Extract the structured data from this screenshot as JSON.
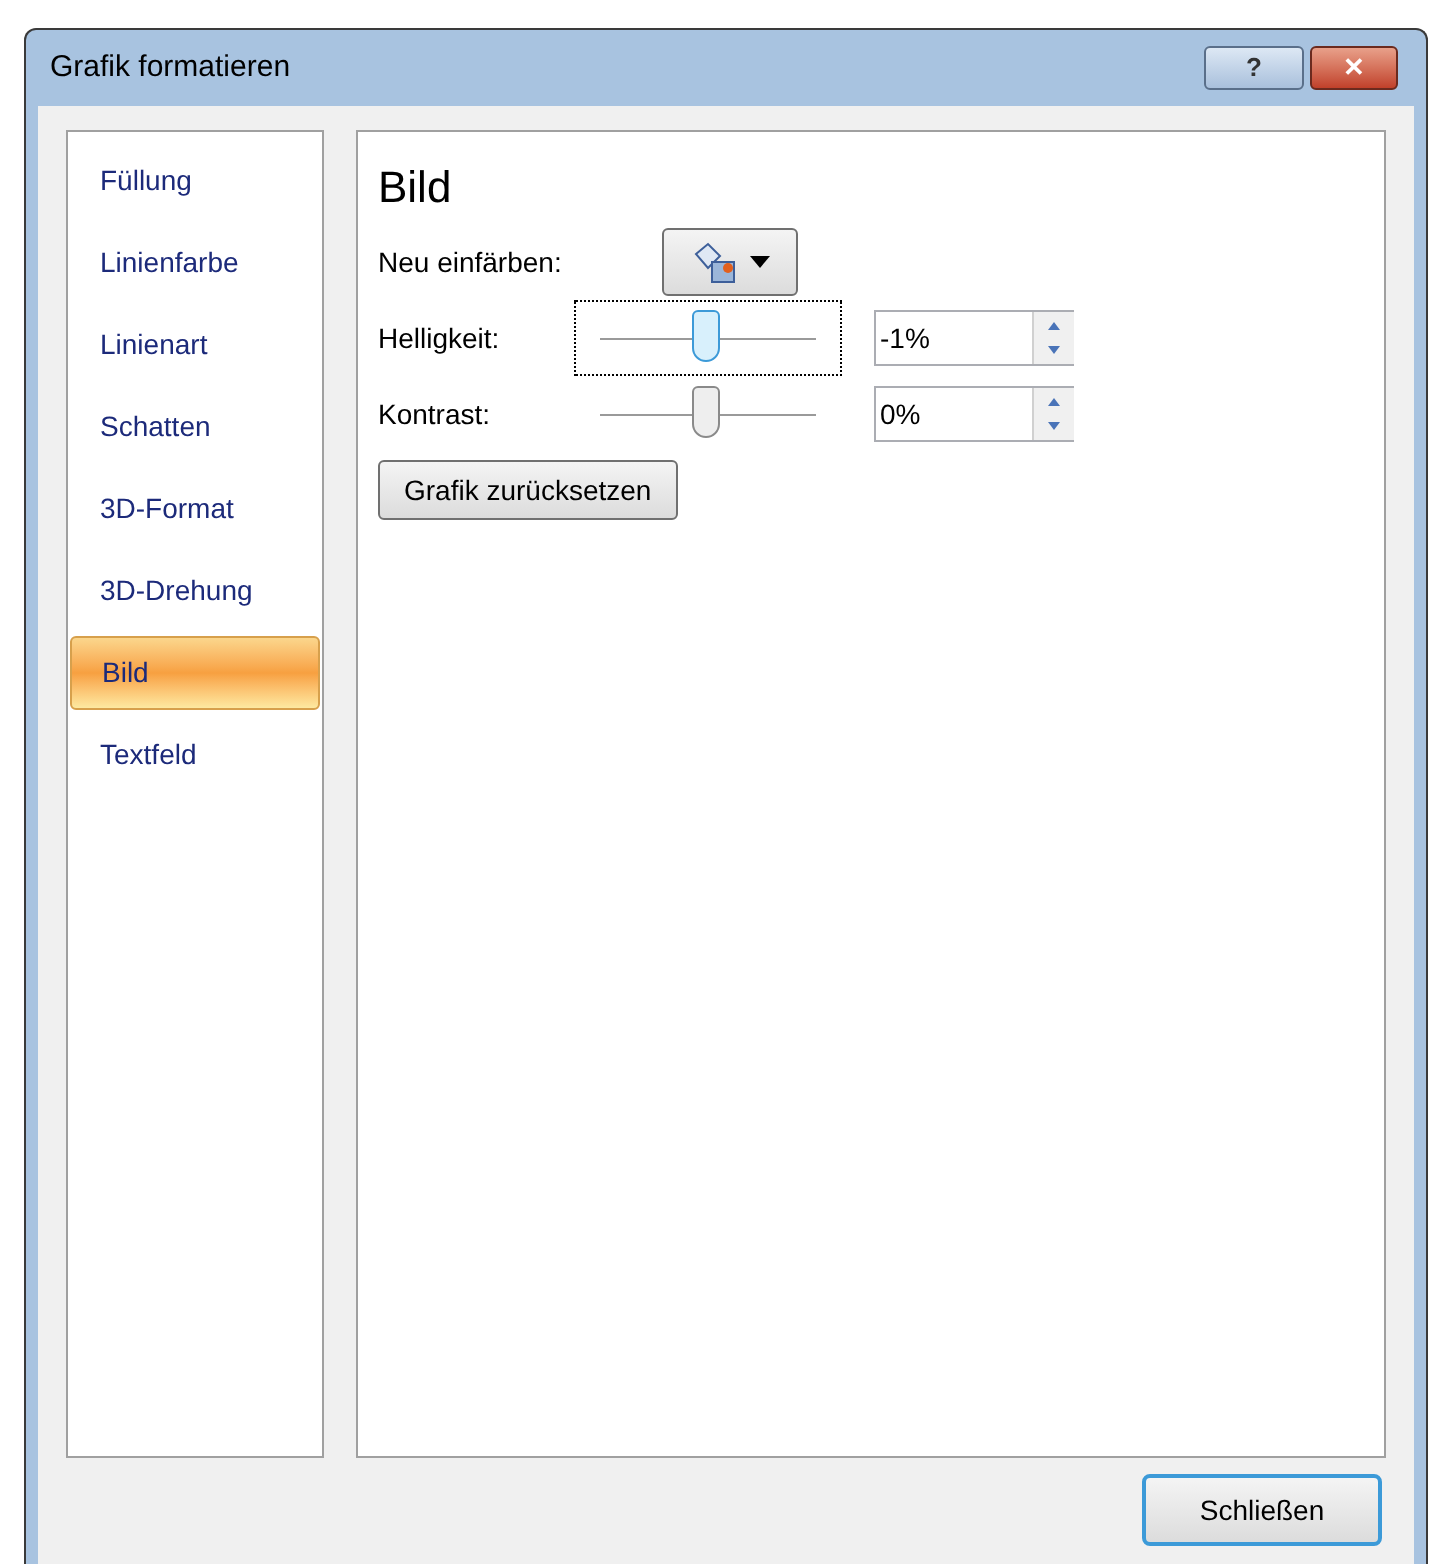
{
  "window": {
    "title": "Grafik formatieren"
  },
  "title_buttons": [
    {
      "kind": "help",
      "label": "?"
    },
    {
      "kind": "close",
      "label": "✕"
    }
  ],
  "sidebar": {
    "items": [
      {
        "label": "Füllung",
        "selected": false
      },
      {
        "label": "Linienfarbe",
        "selected": false
      },
      {
        "label": "Linienart",
        "selected": false
      },
      {
        "label": "Schatten",
        "selected": false
      },
      {
        "label": "3D-Format",
        "selected": false
      },
      {
        "label": "3D-Drehung",
        "selected": false
      },
      {
        "label": "Bild",
        "selected": true
      },
      {
        "label": "Textfeld",
        "selected": false
      }
    ]
  },
  "panel": {
    "heading": "Bild",
    "recolor": {
      "label": "Neu einfärben:"
    },
    "sliders": [
      {
        "label": "Helligkeit:",
        "level": 0.49,
        "focused": true,
        "value": "-1%"
      },
      {
        "label": "Kontrast:",
        "level": 0.49,
        "focused": false,
        "value": "0%"
      }
    ],
    "reset_button": "Grafik zurücksetzen"
  },
  "footer": {
    "close_button": "Schließen"
  }
}
